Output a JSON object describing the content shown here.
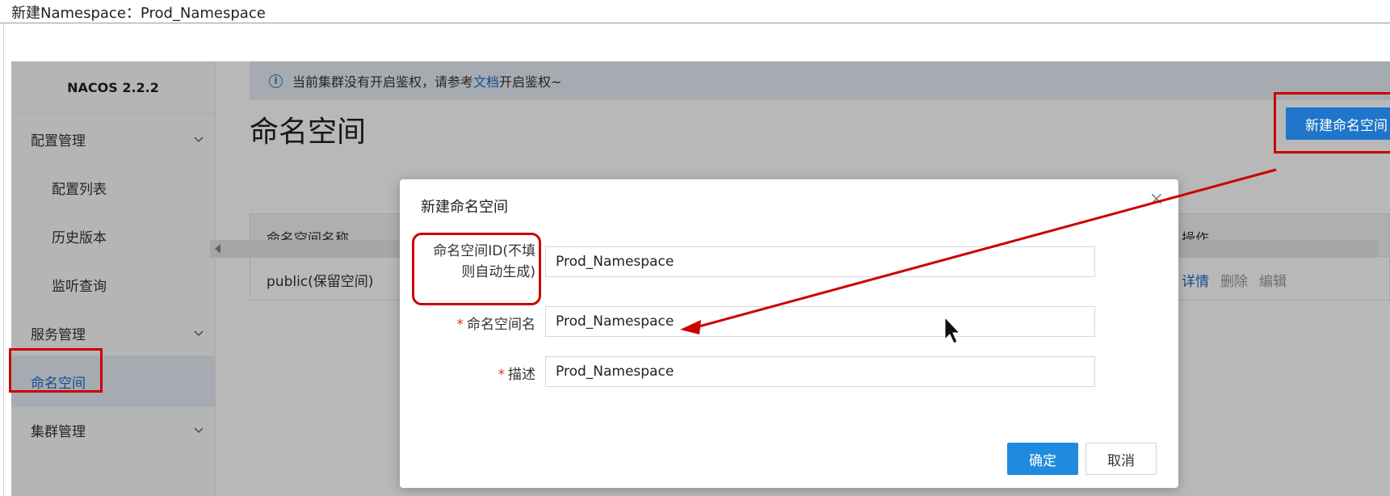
{
  "window": {
    "caption": "新建Namespace：Prod_Namespace"
  },
  "sidebar": {
    "brand": "NACOS 2.2.2",
    "items": [
      {
        "label": "配置管理"
      },
      {
        "label": "配置列表"
      },
      {
        "label": "历史版本"
      },
      {
        "label": "监听查询"
      },
      {
        "label": "服务管理"
      },
      {
        "label": "命名空间"
      },
      {
        "label": "集群管理"
      }
    ]
  },
  "notice": {
    "prefix": "当前集群没有开启鉴权，请参考",
    "link": "文档",
    "suffix": "开启鉴权~"
  },
  "main": {
    "title": "命名空间",
    "new_button": "新建命名空间",
    "table": {
      "headers": [
        "命名空间名称",
        "操作"
      ],
      "rows": [
        {
          "name": "public(保留空间)",
          "ops": [
            "详情",
            "删除",
            "编辑"
          ]
        }
      ]
    }
  },
  "dialog": {
    "title": "新建命名空间",
    "close": "×",
    "fields": [
      {
        "label_line1": "命名空间ID(不填",
        "label_line2": "则自动生成)",
        "value": "Prod_Namespace"
      },
      {
        "required": "*",
        "label": "命名空间名",
        "value": "Prod_Namespace"
      },
      {
        "required": "*",
        "label": "描述",
        "value": "Prod_Namespace"
      }
    ],
    "ok": "确定",
    "cancel": "取消"
  },
  "colors": {
    "accent": "#1f75c9",
    "annotation": "#cc0000",
    "link": "#1e6bc4"
  },
  "icons": [
    "chevron-down-icon",
    "info-icon",
    "close-icon",
    "cursor-icon"
  ]
}
